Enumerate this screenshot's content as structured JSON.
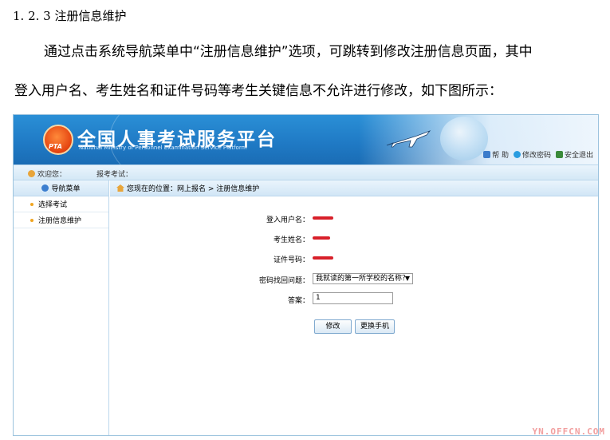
{
  "doc": {
    "heading": "1. 2. 3  注册信息维护",
    "para1": "通过点击系统导航菜单中“注册信息维护”选项，可跳转到修改注册信息页面，其中",
    "para2": "登入用户名、考生姓名和证件号码等考生关键信息不允许进行修改，如下图所示："
  },
  "app": {
    "title": "全国人事考试服务平台",
    "subtitle": "National Ministry of Personnel Examination Service Platform",
    "badge_text": "PTA",
    "top_links": [
      {
        "label": "帮 助",
        "icon": "help-icon"
      },
      {
        "label": "修改密码",
        "icon": "password-icon"
      },
      {
        "label": "安全退出",
        "icon": "exit-icon"
      }
    ],
    "welcome_label": "欢迎您：",
    "exam_label": "报考考试：",
    "sidebar": {
      "header": "导航菜单",
      "items": [
        {
          "label": "选择考试"
        },
        {
          "label": "注册信息维护"
        }
      ]
    },
    "breadcrumb": "您现在的位置：网上报名 > 注册信息维护",
    "form": {
      "username_label": "登入用户名：",
      "name_label": "考生姓名：",
      "id_label": "证件号码：",
      "question_label": "密码找回问题：",
      "question_value": "我就读的第一所学校的名称？",
      "answer_label": "答案：",
      "answer_value": "1"
    },
    "buttons": {
      "modify": "修改",
      "change_phone": "更换手机"
    },
    "colors": {
      "banner": "#1f79c4",
      "redaction": "#d8202a",
      "accent_orange": "#e4420f"
    }
  },
  "watermark": "YN.OFFCN.COM"
}
